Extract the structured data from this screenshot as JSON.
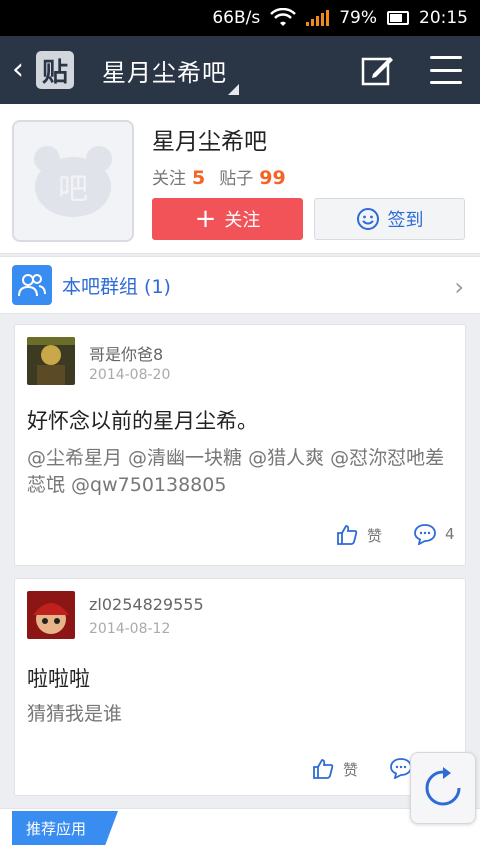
{
  "status_bar": {
    "speed": "66B/s",
    "battery": "79%",
    "time": "20:15"
  },
  "header": {
    "tie_badge": "贴",
    "title": "星月尘希吧"
  },
  "profile": {
    "name": "星月尘希吧",
    "follow_label": "关注",
    "follow_count": "5",
    "posts_label": "贴子",
    "posts_count": "99",
    "follow_button": "关注",
    "signin_button": "签到"
  },
  "group": {
    "label": "本吧群组 (1)"
  },
  "posts": [
    {
      "author": "哥是你爸8",
      "date": "2014-08-20",
      "title": "好怀念以前的星月尘希。",
      "body": "@尘希星月 @清幽一块糖 @猎人爽 @怼沵怼吔差蕊氓 @qw750138805",
      "like_label": "赞",
      "comment_count": "4"
    },
    {
      "author": "zl0254829555",
      "date": "2014-08-12",
      "title": "啦啦啦",
      "body": "猜猜我是谁",
      "like_label": "赞",
      "comment_count": ""
    }
  ],
  "recommend": {
    "label": "推荐应用"
  },
  "icons": {
    "back": "chevron-left-icon",
    "edit": "edit-icon",
    "menu": "menu-icon",
    "group": "people-icon",
    "like": "thumbs-up-icon",
    "comment": "comment-icon",
    "refresh": "refresh-icon"
  }
}
